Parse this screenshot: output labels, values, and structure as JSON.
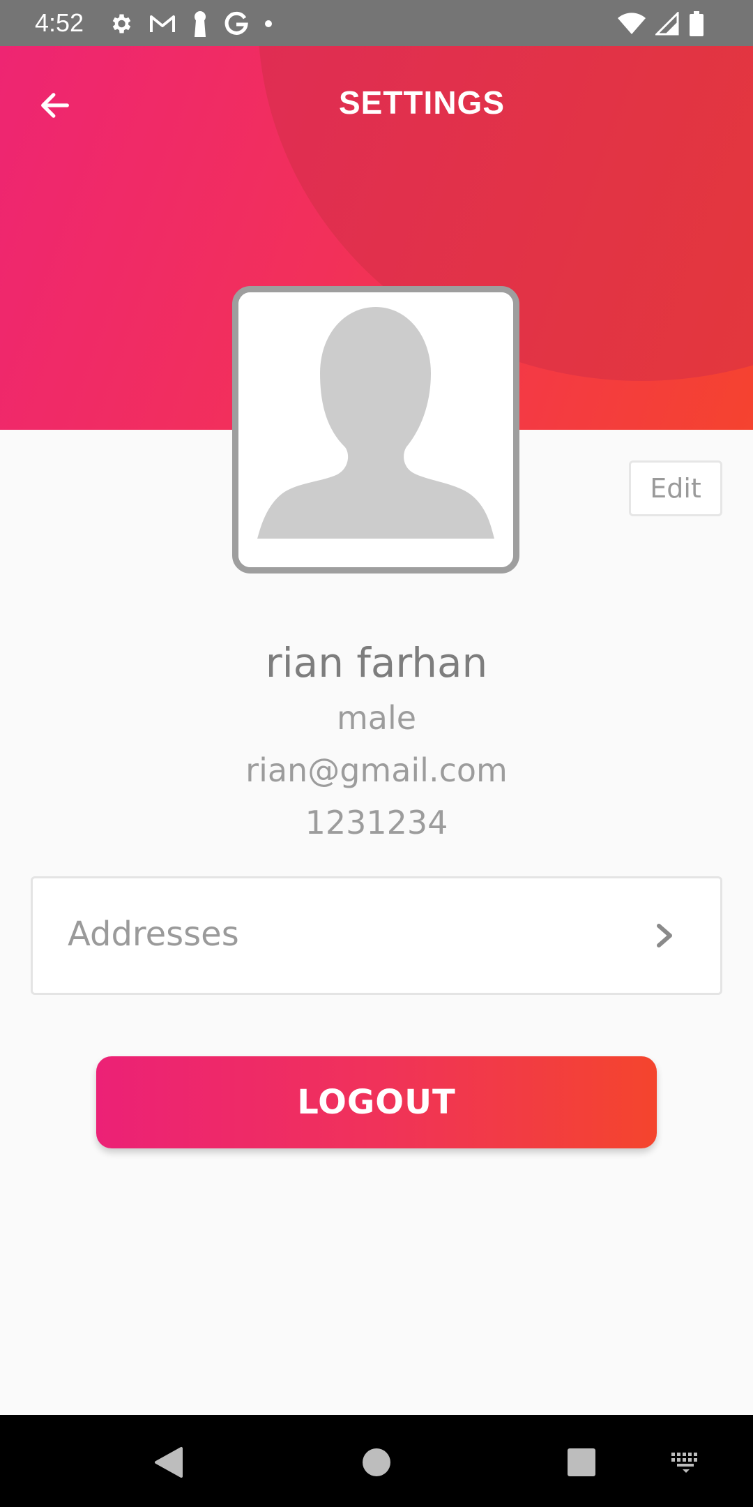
{
  "status_bar": {
    "time": "4:52",
    "icons_left": [
      "settings-icon",
      "gmail-icon",
      "keyhole-icon",
      "google-icon",
      "dot-icon"
    ],
    "icons_right": [
      "wifi-icon",
      "signal-icon",
      "battery-icon"
    ]
  },
  "header": {
    "title": "SETTINGS",
    "back_icon": "arrow-left-icon",
    "colors": {
      "gradient_start": "#ee2572",
      "gradient_end": "#f5432f"
    }
  },
  "profile": {
    "avatar_icon": "person-silhouette-icon",
    "edit_label": "Edit",
    "name": "rian farhan",
    "gender": "male",
    "email": "rian@gmail.com",
    "phone": "1231234"
  },
  "menu": {
    "addresses_label": "Addresses",
    "chevron_icon": "chevron-right-icon"
  },
  "logout_label": "LOGOUT",
  "nav_bar": {
    "icons": [
      "back-triangle-icon",
      "home-circle-icon",
      "recents-square-icon",
      "keyboard-icon"
    ]
  }
}
